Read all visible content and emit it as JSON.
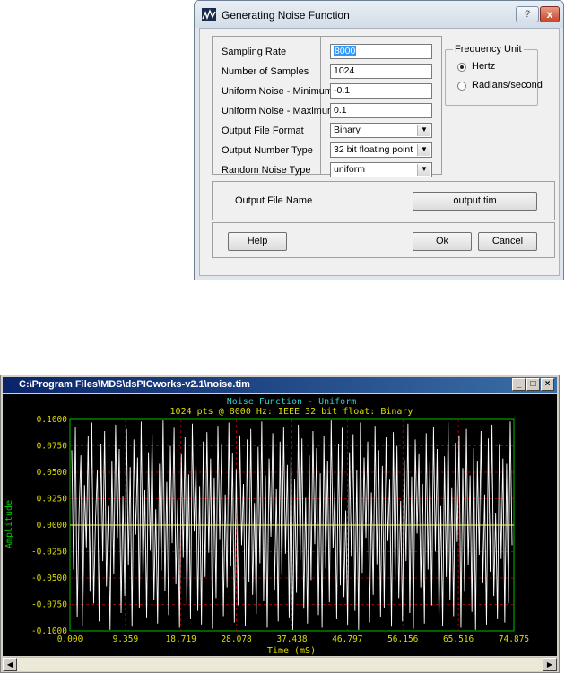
{
  "dialog": {
    "title": "Generating Noise Function",
    "help_icon": "?",
    "close_icon": "x",
    "fields": [
      {
        "label": "Sampling Rate",
        "value": "8000",
        "kind": "text",
        "selected": true
      },
      {
        "label": "Number of Samples",
        "value": "1024",
        "kind": "text"
      },
      {
        "label": "Uniform Noise - Minimum",
        "value": "-0.1",
        "kind": "text"
      },
      {
        "label": "Uniform Noise - Maximum",
        "value": "0.1",
        "kind": "text"
      },
      {
        "label": "Output File Format",
        "value": "Binary",
        "kind": "select"
      },
      {
        "label": "Output Number Type",
        "value": "32 bit floating point",
        "kind": "select"
      },
      {
        "label": "Random Noise Type",
        "value": "uniform",
        "kind": "select"
      }
    ],
    "frequency_unit": {
      "legend": "Frequency Unit",
      "options": [
        {
          "label": "Hertz",
          "checked": true
        },
        {
          "label": "Radians/second",
          "checked": false
        }
      ]
    },
    "output_file": {
      "label": "Output File Name",
      "button": "output.tim"
    },
    "buttons": {
      "help": "Help",
      "ok": "Ok",
      "cancel": "Cancel"
    }
  },
  "plot_window": {
    "title": "C:\\Program Files\\MDS\\dsPICworks-v2.1\\noise.tim",
    "controls": {
      "minimize": "_",
      "maximize": "□",
      "close": "×"
    },
    "colors": {
      "background": "#000000",
      "frame": "#00c000",
      "grid": "#c00000",
      "trace": "#ffffff",
      "zero_line": "#ffff66",
      "title": "#33cccc",
      "label": "#dddd00"
    }
  },
  "chart_data": {
    "type": "line",
    "title": "Noise Function - Uniform",
    "subtitle": "1024 pts @ 8000 Hz: IEEE 32 bit float: Binary",
    "xlabel": "Time (mS)",
    "ylabel": "Amplitude",
    "xlim": [
      0,
      74.875
    ],
    "ylim": [
      -0.1,
      0.1
    ],
    "x_ticks": [
      "0.000",
      "9.359",
      "18.719",
      "28.078",
      "37.438",
      "46.797",
      "56.156",
      "65.516",
      "74.875"
    ],
    "y_ticks": [
      "0.1000",
      "0.0750",
      "0.0500",
      "0.0250",
      "0.0000",
      "-0.0250",
      "-0.0500",
      "-0.0750",
      "-0.1000"
    ],
    "grid": true,
    "series": [
      {
        "points": 1024,
        "sample_rate_hz": 8000,
        "distribution": "uniform",
        "min": -0.1,
        "max": 0.1,
        "values": [
          0.071,
          -0.042,
          0.093,
          -0.087,
          0.012,
          0.066,
          -0.095,
          0.038,
          -0.021,
          0.084,
          -0.063,
          0.097,
          -0.074,
          0.005,
          0.052,
          -0.091,
          0.077,
          -0.034,
          0.089,
          -0.058,
          0.018,
          -0.099,
          0.061,
          -0.046,
          0.095,
          -0.012,
          0.072,
          -0.083,
          0.027,
          -0.067,
          0.091,
          -0.038,
          0.055,
          -0.096,
          0.081,
          -0.009,
          0.064,
          -0.078,
          0.098,
          -0.051,
          0.033,
          -0.088,
          0.069,
          -0.024,
          0.086,
          -0.071,
          0.015,
          -0.093,
          0.058,
          -0.043,
          0.099,
          -0.062,
          0.041,
          -0.085,
          0.075,
          -0.017,
          0.092,
          -0.056,
          0.024,
          -0.097,
          0.067,
          -0.031,
          0.083,
          -0.075,
          0.048,
          -0.089,
          0.096,
          -0.006,
          0.059,
          -0.081,
          0.037,
          -0.094,
          0.079,
          -0.049,
          0.088,
          -0.026,
          0.063,
          -0.098,
          0.045,
          -0.069,
          0.094,
          -0.014,
          0.076,
          -0.086,
          0.029,
          -0.059,
          0.097,
          -0.039,
          0.068,
          -0.092,
          0.053,
          -0.076,
          0.085,
          -0.019,
          0.039,
          -0.095,
          0.081,
          -0.054,
          0.091,
          -0.066,
          0.021,
          -0.084,
          0.074,
          -0.036,
          0.098,
          -0.072,
          0.047,
          -0.097,
          0.063,
          -0.011,
          0.087,
          -0.061,
          0.034,
          -0.091,
          0.079,
          -0.047,
          0.093,
          -0.027,
          0.057,
          -0.088,
          0.071,
          -0.099,
          0.044,
          -0.064,
          0.095,
          -0.033,
          0.082,
          -0.079,
          0.026,
          -0.093,
          0.066,
          -0.052,
          0.089,
          -0.018,
          0.073,
          -0.085,
          0.049,
          -0.097,
          0.084,
          -0.041,
          0.061,
          -0.073,
          0.099,
          -0.022,
          0.036,
          -0.089,
          0.077,
          -0.057,
          0.092,
          -0.068,
          0.014,
          -0.094,
          0.069,
          -0.029,
          0.086,
          -0.081,
          0.052,
          -0.099,
          0.097,
          -0.045,
          0.064,
          -0.012,
          0.079,
          -0.092,
          0.031,
          -0.066,
          0.094,
          -0.037,
          0.071,
          -0.087,
          0.056,
          -0.078,
          0.083,
          -0.015,
          0.043,
          -0.096,
          0.088,
          -0.053,
          0.075,
          -0.069,
          0.023,
          -0.091,
          0.062,
          -0.034,
          0.096,
          -0.083,
          0.046,
          -0.098,
          0.081,
          -0.008,
          0.067,
          -0.059,
          0.039,
          -0.093,
          0.087,
          -0.042,
          0.059,
          -0.076,
          0.093,
          -0.025,
          0.072,
          -0.088,
          0.018,
          -0.095,
          0.065,
          -0.049,
          0.097,
          -0.071,
          0.035,
          -0.086,
          0.078,
          -0.016,
          0.085,
          -0.097,
          0.054,
          -0.063,
          0.091,
          -0.038,
          0.047,
          -0.082,
          0.073,
          -0.099,
          0.061,
          -0.028,
          0.089,
          -0.055,
          0.029,
          -0.094,
          0.082,
          -0.044,
          0.095,
          -0.067,
          0.011,
          -0.089,
          0.076,
          -0.032,
          0.063,
          -0.092,
          0.058,
          -0.074,
          0.098,
          -0.019
        ]
      }
    ]
  }
}
